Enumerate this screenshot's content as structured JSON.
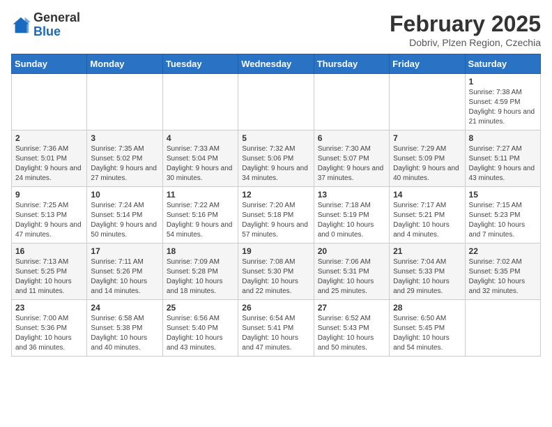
{
  "header": {
    "logo_general": "General",
    "logo_blue": "Blue",
    "month_title": "February 2025",
    "location": "Dobriv, Plzen Region, Czechia"
  },
  "weekdays": [
    "Sunday",
    "Monday",
    "Tuesday",
    "Wednesday",
    "Thursday",
    "Friday",
    "Saturday"
  ],
  "weeks": [
    [
      {
        "day": "",
        "info": ""
      },
      {
        "day": "",
        "info": ""
      },
      {
        "day": "",
        "info": ""
      },
      {
        "day": "",
        "info": ""
      },
      {
        "day": "",
        "info": ""
      },
      {
        "day": "",
        "info": ""
      },
      {
        "day": "1",
        "info": "Sunrise: 7:38 AM\nSunset: 4:59 PM\nDaylight: 9 hours and 21 minutes."
      }
    ],
    [
      {
        "day": "2",
        "info": "Sunrise: 7:36 AM\nSunset: 5:01 PM\nDaylight: 9 hours and 24 minutes."
      },
      {
        "day": "3",
        "info": "Sunrise: 7:35 AM\nSunset: 5:02 PM\nDaylight: 9 hours and 27 minutes."
      },
      {
        "day": "4",
        "info": "Sunrise: 7:33 AM\nSunset: 5:04 PM\nDaylight: 9 hours and 30 minutes."
      },
      {
        "day": "5",
        "info": "Sunrise: 7:32 AM\nSunset: 5:06 PM\nDaylight: 9 hours and 34 minutes."
      },
      {
        "day": "6",
        "info": "Sunrise: 7:30 AM\nSunset: 5:07 PM\nDaylight: 9 hours and 37 minutes."
      },
      {
        "day": "7",
        "info": "Sunrise: 7:29 AM\nSunset: 5:09 PM\nDaylight: 9 hours and 40 minutes."
      },
      {
        "day": "8",
        "info": "Sunrise: 7:27 AM\nSunset: 5:11 PM\nDaylight: 9 hours and 43 minutes."
      }
    ],
    [
      {
        "day": "9",
        "info": "Sunrise: 7:25 AM\nSunset: 5:13 PM\nDaylight: 9 hours and 47 minutes."
      },
      {
        "day": "10",
        "info": "Sunrise: 7:24 AM\nSunset: 5:14 PM\nDaylight: 9 hours and 50 minutes."
      },
      {
        "day": "11",
        "info": "Sunrise: 7:22 AM\nSunset: 5:16 PM\nDaylight: 9 hours and 54 minutes."
      },
      {
        "day": "12",
        "info": "Sunrise: 7:20 AM\nSunset: 5:18 PM\nDaylight: 9 hours and 57 minutes."
      },
      {
        "day": "13",
        "info": "Sunrise: 7:18 AM\nSunset: 5:19 PM\nDaylight: 10 hours and 0 minutes."
      },
      {
        "day": "14",
        "info": "Sunrise: 7:17 AM\nSunset: 5:21 PM\nDaylight: 10 hours and 4 minutes."
      },
      {
        "day": "15",
        "info": "Sunrise: 7:15 AM\nSunset: 5:23 PM\nDaylight: 10 hours and 7 minutes."
      }
    ],
    [
      {
        "day": "16",
        "info": "Sunrise: 7:13 AM\nSunset: 5:25 PM\nDaylight: 10 hours and 11 minutes."
      },
      {
        "day": "17",
        "info": "Sunrise: 7:11 AM\nSunset: 5:26 PM\nDaylight: 10 hours and 14 minutes."
      },
      {
        "day": "18",
        "info": "Sunrise: 7:09 AM\nSunset: 5:28 PM\nDaylight: 10 hours and 18 minutes."
      },
      {
        "day": "19",
        "info": "Sunrise: 7:08 AM\nSunset: 5:30 PM\nDaylight: 10 hours and 22 minutes."
      },
      {
        "day": "20",
        "info": "Sunrise: 7:06 AM\nSunset: 5:31 PM\nDaylight: 10 hours and 25 minutes."
      },
      {
        "day": "21",
        "info": "Sunrise: 7:04 AM\nSunset: 5:33 PM\nDaylight: 10 hours and 29 minutes."
      },
      {
        "day": "22",
        "info": "Sunrise: 7:02 AM\nSunset: 5:35 PM\nDaylight: 10 hours and 32 minutes."
      }
    ],
    [
      {
        "day": "23",
        "info": "Sunrise: 7:00 AM\nSunset: 5:36 PM\nDaylight: 10 hours and 36 minutes."
      },
      {
        "day": "24",
        "info": "Sunrise: 6:58 AM\nSunset: 5:38 PM\nDaylight: 10 hours and 40 minutes."
      },
      {
        "day": "25",
        "info": "Sunrise: 6:56 AM\nSunset: 5:40 PM\nDaylight: 10 hours and 43 minutes."
      },
      {
        "day": "26",
        "info": "Sunrise: 6:54 AM\nSunset: 5:41 PM\nDaylight: 10 hours and 47 minutes."
      },
      {
        "day": "27",
        "info": "Sunrise: 6:52 AM\nSunset: 5:43 PM\nDaylight: 10 hours and 50 minutes."
      },
      {
        "day": "28",
        "info": "Sunrise: 6:50 AM\nSunset: 5:45 PM\nDaylight: 10 hours and 54 minutes."
      },
      {
        "day": "",
        "info": ""
      }
    ]
  ]
}
